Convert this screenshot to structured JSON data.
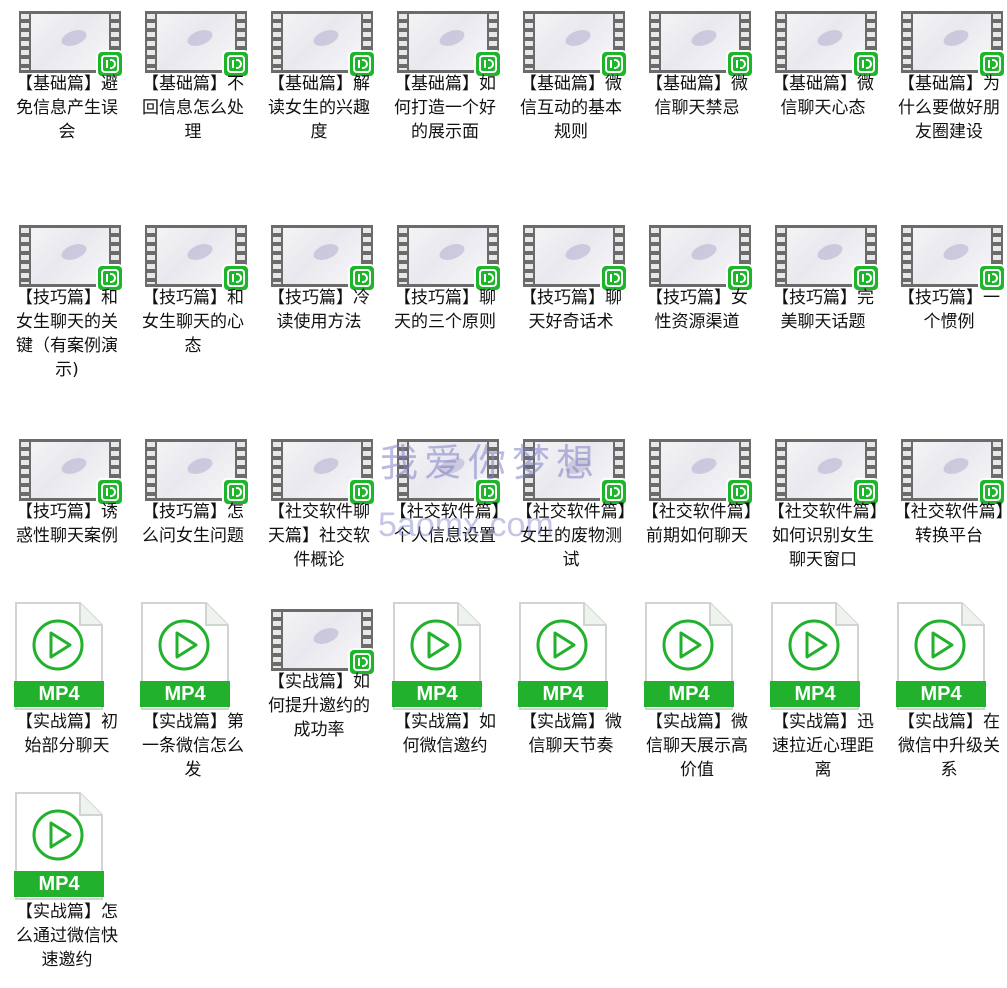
{
  "colors": {
    "accent": "#1db52a",
    "text": "#111111",
    "watermark": "#7f82c9"
  },
  "items": [
    {
      "type": "video",
      "label": "【基础篇】避免信息产生误会"
    },
    {
      "type": "video",
      "label": "【基础篇】不回信息怎么处理"
    },
    {
      "type": "video",
      "label": "【基础篇】解读女生的兴趣度"
    },
    {
      "type": "video",
      "label": "【基础篇】如何打造一个好的展示面"
    },
    {
      "type": "video",
      "label": "【基础篇】微信互动的基本规则"
    },
    {
      "type": "video",
      "label": "【基础篇】微信聊天禁忌"
    },
    {
      "type": "video",
      "label": "【基础篇】微信聊天心态"
    },
    {
      "type": "video",
      "label": "【基础篇】为什么要做好朋友圈建设"
    },
    {
      "type": "video",
      "label": "【技巧篇】和女生聊天的关键（有案例演示)"
    },
    {
      "type": "video",
      "label": "【技巧篇】和女生聊天的心态"
    },
    {
      "type": "video",
      "label": "【技巧篇】冷读使用方法"
    },
    {
      "type": "video",
      "label": "【技巧篇】聊天的三个原则"
    },
    {
      "type": "video",
      "label": "【技巧篇】聊天好奇话术"
    },
    {
      "type": "video",
      "label": "【技巧篇】女性资源渠道"
    },
    {
      "type": "video",
      "label": "【技巧篇】完美聊天话题"
    },
    {
      "type": "video",
      "label": "【技巧篇】一个惯例"
    },
    {
      "type": "video",
      "label": "【技巧篇】诱惑性聊天案例"
    },
    {
      "type": "video",
      "label": "【技巧篇】怎么问女生问题"
    },
    {
      "type": "video",
      "label": "【社交软件聊天篇】社交软件概论"
    },
    {
      "type": "video",
      "label": "【社交软件篇】个人信息设置"
    },
    {
      "type": "video",
      "label": "【社交软件篇】女生的废物测试"
    },
    {
      "type": "video",
      "label": "【社交软件篇】前期如何聊天"
    },
    {
      "type": "video",
      "label": "【社交软件篇】如何识别女生聊天窗口"
    },
    {
      "type": "video",
      "label": "【社交软件篇】转换平台"
    },
    {
      "type": "mp4",
      "label": "【实战篇】初始部分聊天"
    },
    {
      "type": "mp4",
      "label": "【实战篇】第一条微信怎么发"
    },
    {
      "type": "video",
      "label": "【实战篇】如何提升邀约的成功率"
    },
    {
      "type": "mp4",
      "label": "【实战篇】如何微信邀约"
    },
    {
      "type": "mp4",
      "label": "【实战篇】微信聊天节奏"
    },
    {
      "type": "mp4",
      "label": "【实战篇】微信聊天展示高价值"
    },
    {
      "type": "mp4",
      "label": "【实战篇】迅速拉近心理距离"
    },
    {
      "type": "mp4",
      "label": "【实战篇】在微信中升级关系"
    },
    {
      "type": "mp4",
      "label": "【实战篇】怎么通过微信快速邀约"
    }
  ],
  "file_ext": "MP4",
  "watermark": {
    "line1": "我爱你梦想",
    "line2": "5aomx.com"
  }
}
